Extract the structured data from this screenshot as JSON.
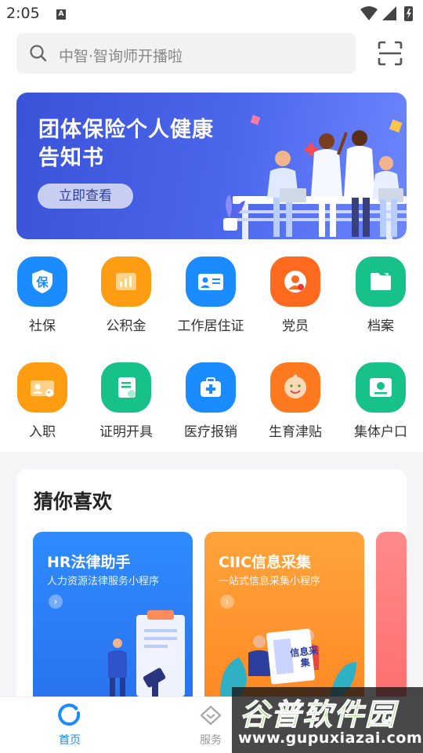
{
  "status_bar": {
    "time": "2:05",
    "notif_letter": "A"
  },
  "search": {
    "placeholder": "中智·智询师开播啦"
  },
  "banner": {
    "title_line1": "团体保险个人健康",
    "title_line2": "告知书",
    "button_label": "立即查看"
  },
  "services_row1": [
    {
      "label": "社保",
      "icon": "shield-icon",
      "color": "#1a8cff"
    },
    {
      "label": "公积金",
      "icon": "chart-icon",
      "color": "#ff9d12"
    },
    {
      "label": "工作居住证",
      "icon": "id-card-icon",
      "color": "#1a8cff"
    },
    {
      "label": "党员",
      "icon": "party-member-icon",
      "color": "#ff6a1e"
    },
    {
      "label": "档案",
      "icon": "folder-icon",
      "color": "#19c18a"
    }
  ],
  "services_row2": [
    {
      "label": "入职",
      "icon": "badge-icon",
      "color": "#ff9d12"
    },
    {
      "label": "证明开具",
      "icon": "certificate-icon",
      "color": "#19c18a"
    },
    {
      "label": "医疗报销",
      "icon": "medical-kit-icon",
      "color": "#1a8cff"
    },
    {
      "label": "生育津贴",
      "icon": "baby-face-icon",
      "color": "#ff7a1e"
    },
    {
      "label": "集体户口",
      "icon": "household-icon",
      "color": "#19c18a"
    }
  ],
  "guess": {
    "title": "猜你喜欢",
    "cards": [
      {
        "title": "HR法律助手",
        "subtitle": "人力资源法律服务小程序",
        "arrow": "›"
      },
      {
        "title": "CIIC信息采集",
        "subtitle": "一站式信息采集小程序",
        "arrow": "›",
        "art_text": "信息采集"
      }
    ]
  },
  "bottom_nav": {
    "home_label": "首页",
    "service_label": "服务"
  },
  "watermark": {
    "logo": "谷普软件园",
    "url": "www.gupuxiazai.com"
  },
  "colors": {
    "accent": "#1a8cff",
    "banner": "#4b67ec"
  }
}
